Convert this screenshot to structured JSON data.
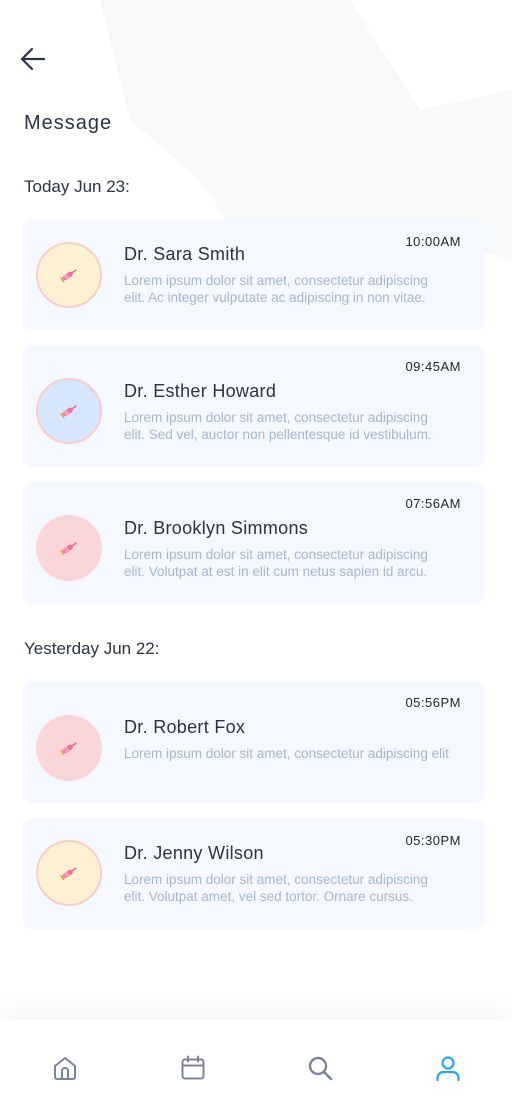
{
  "header": {
    "title": "Message"
  },
  "sections": [
    {
      "heading": "Today Jun 23:",
      "messages": [
        {
          "name": "Dr. Sara Smith",
          "time": "10:00AM",
          "preview_line1": "Lorem ipsum dolor sit amet, consectetur adipiscing",
          "preview_line2": "elit. Ac integer vulputate ac adipiscing in non vitae.",
          "avatar_color": "#fdf0d3",
          "avatar_border": "#f7cfc8"
        },
        {
          "name": "Dr. Esther Howard",
          "time": "09:45AM",
          "preview_line1": "Lorem ipsum dolor sit amet, consectetur adipiscing",
          "preview_line2": "elit. Sed vel, auctor non pellentesque id vestibulum.",
          "avatar_color": "#d5e6fd",
          "avatar_border": "#f7cfc8"
        },
        {
          "name": "Dr. Brooklyn Simmons",
          "time": "07:56AM",
          "preview_line1": "Lorem ipsum dolor sit amet, consectetur adipiscing",
          "preview_line2": "elit. Volutpat at est in elit cum netus sapien id arcu.",
          "avatar_color": "#fad6d8",
          "avatar_border": "#fad6d8"
        }
      ]
    },
    {
      "heading": "Yesterday Jun 22:",
      "messages": [
        {
          "name": "Dr. Robert Fox",
          "time": "05:56PM",
          "preview_line1": "Lorem ipsum dolor sit amet, consectetur adipiscing elit",
          "avatar_color": "#fad6d8",
          "avatar_border": "#fad6d8"
        },
        {
          "name": "Dr. Jenny Wilson",
          "time": "05:30PM",
          "preview_line1": "Lorem ipsum dolor sit amet, consectetur adipiscing",
          "preview_line2": "elit. Volutpat amet, vel sed tortor. Ornare cursus.",
          "avatar_color": "#fdf0d3",
          "avatar_border": "#f7cfc8"
        }
      ]
    }
  ],
  "avatar_icon": "syringe-icon",
  "bottom_nav": [
    {
      "icon": "home-icon",
      "active": false
    },
    {
      "icon": "calendar-icon",
      "active": false
    },
    {
      "icon": "search-icon",
      "active": false
    },
    {
      "icon": "user-icon",
      "active": true
    }
  ],
  "colors": {
    "accent": "#2aa3e8",
    "nav_inactive": "#7b8597",
    "card_bg": "#f5f8fe",
    "preview_text": "#a6b7cf"
  }
}
